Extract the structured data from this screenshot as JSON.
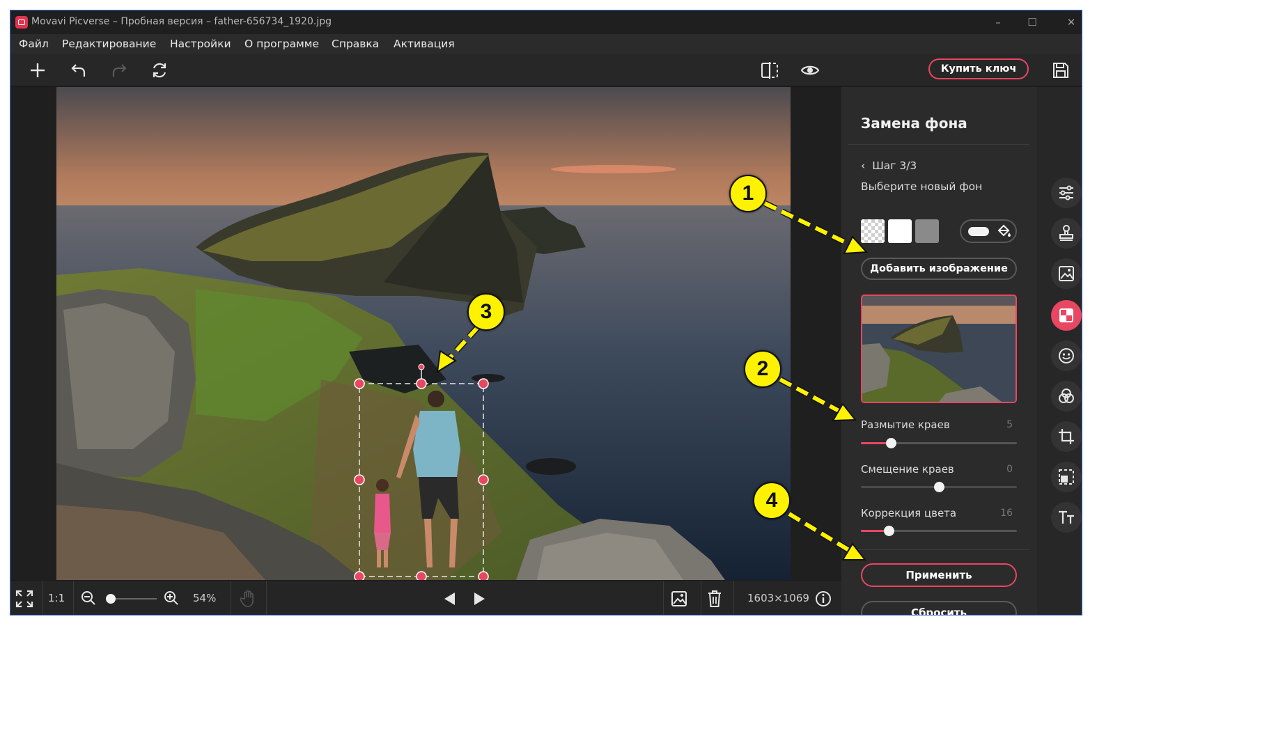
{
  "window": {
    "title": "Movavi Picverse – Пробная версия – father-656734_1920.jpg",
    "controls": {
      "minimize": "–",
      "maximize": "☐",
      "close": "✕"
    }
  },
  "menu": [
    "Файл",
    "Редактирование",
    "Настройки",
    "О программе",
    "Справка",
    "Активация"
  ],
  "toolbar": {
    "buy_key": "Купить ключ",
    "icons": [
      "add-icon",
      "undo-icon",
      "redo-icon",
      "rotate-icon",
      "compare-icon",
      "preview-eye-icon",
      "save-icon"
    ]
  },
  "panel": {
    "title": "Замена фона",
    "step": "Шаг 3/3",
    "instruction": "Выберите новый фон",
    "add_image_button": "Добавить изображение",
    "sliders": [
      {
        "label": "Размытие краев",
        "value": "5",
        "fraction": 0.19
      },
      {
        "label": "Смещение краев",
        "value": "0",
        "fraction": 0.5
      },
      {
        "label": "Коррекция цвета",
        "value": "16",
        "fraction": 0.18
      }
    ],
    "apply_button": "Применить",
    "reset_button": "Сбросить"
  },
  "sidebar_icons": [
    "adjustments-icon",
    "retouch-stamp-icon",
    "image-icon",
    "background-replace-icon",
    "face-icon",
    "color-filters-icon",
    "crop-icon",
    "select-icon",
    "text-icon"
  ],
  "bottom": {
    "one_to_one": "1:1",
    "zoom_percent": "54%",
    "zoom_fraction": 0.05,
    "dimensions": "1603×1069"
  },
  "annotations": [
    "1",
    "2",
    "3",
    "4"
  ],
  "colors": {
    "accent": "#e84761",
    "callout": "#fff200"
  }
}
